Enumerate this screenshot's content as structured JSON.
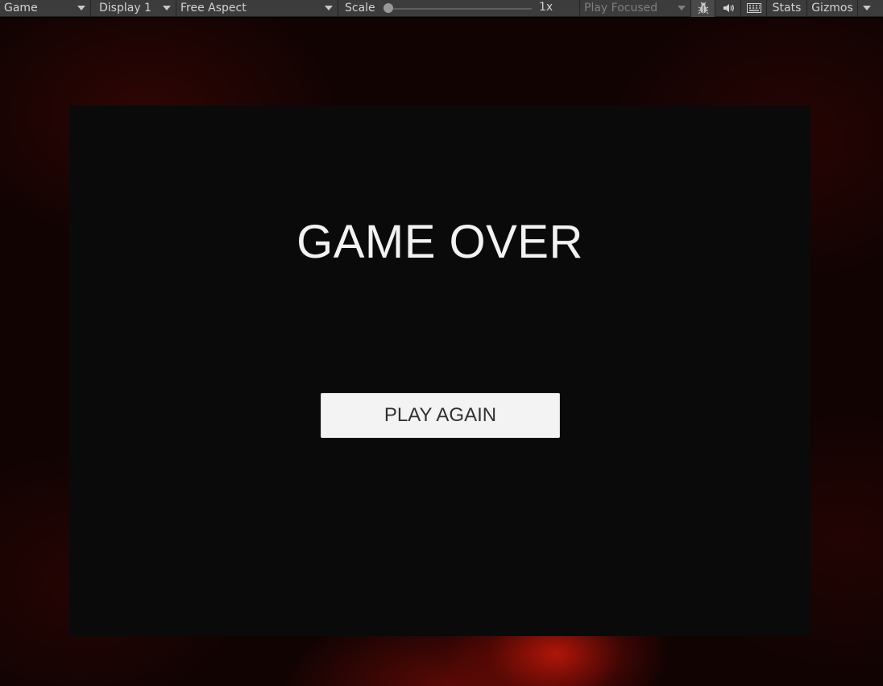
{
  "toolbar": {
    "view_dropdown": "Game",
    "display_dropdown": "Display 1",
    "aspect_dropdown": "Free Aspect",
    "scale_label": "Scale",
    "scale_value": "1x",
    "play_mode_dropdown": "Play Focused",
    "bug_icon": "bug-icon",
    "audio_icon": "speaker-icon",
    "keyboard_icon": "keyboard-icon",
    "stats_label": "Stats",
    "gizmos_label": "Gizmos"
  },
  "game": {
    "title": "GAME OVER",
    "play_again_label": "PLAY AGAIN"
  },
  "colors": {
    "toolbar_bg": "#3c3c3c",
    "panel_bg": "#0a0a0a",
    "button_bg": "#f3f3f3",
    "accent_red": "#c8190a"
  }
}
